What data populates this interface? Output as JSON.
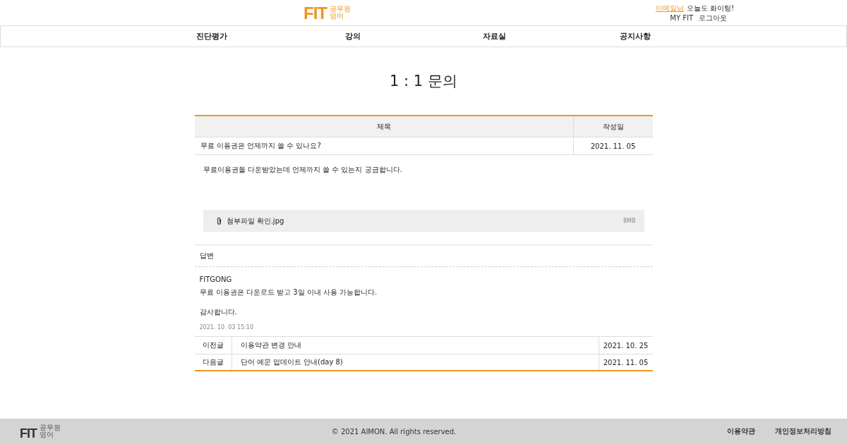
{
  "header": {
    "logo": {
      "mark": "FIT",
      "line_1": "공무원",
      "line_2": "영어"
    },
    "user_name": "이메일님",
    "greeting": "오늘도 화이팅!",
    "links": [
      "MY FIT",
      "로그아웃"
    ]
  },
  "nav": [
    "진단평가",
    "강의",
    "자료실",
    "공지사항"
  ],
  "page_title": "1 : 1 문의",
  "question": {
    "columns": [
      "제목",
      "작성일"
    ],
    "title": "무료 이용권은 언제까지 쓸 수 있나요?",
    "date": "2021. 11. 05",
    "body": "무료이용권을 다운받았는데 언제까지 쓸 수 있는지 궁금합니다.",
    "attachment": {
      "name": "첨부파일 확인.jpg",
      "size": "8MB"
    }
  },
  "answer": {
    "heading": "답변",
    "author": "FITGONG",
    "lines": [
      "무료 이용권은 다운로드 받고 3일 이내 사용 가능합니다.",
      "감사합니다."
    ],
    "timestamp": "2021. 10. 03 15:10"
  },
  "adjacent": [
    {
      "label": "이전글",
      "title": "이용약관 변경 안내",
      "date": "2021. 10. 25"
    },
    {
      "label": "다음글",
      "title": "단어 예문 업데이트 안내(day 8)",
      "date": "2021. 11. 05"
    }
  ],
  "footer": {
    "logo": {
      "mark": "FIT",
      "line_1": "공무원",
      "line_2": "영어"
    },
    "copyright": "© 2021 AIMON. All rights reserved.",
    "links": [
      "이용약관",
      "개인정보처리방침"
    ]
  }
}
